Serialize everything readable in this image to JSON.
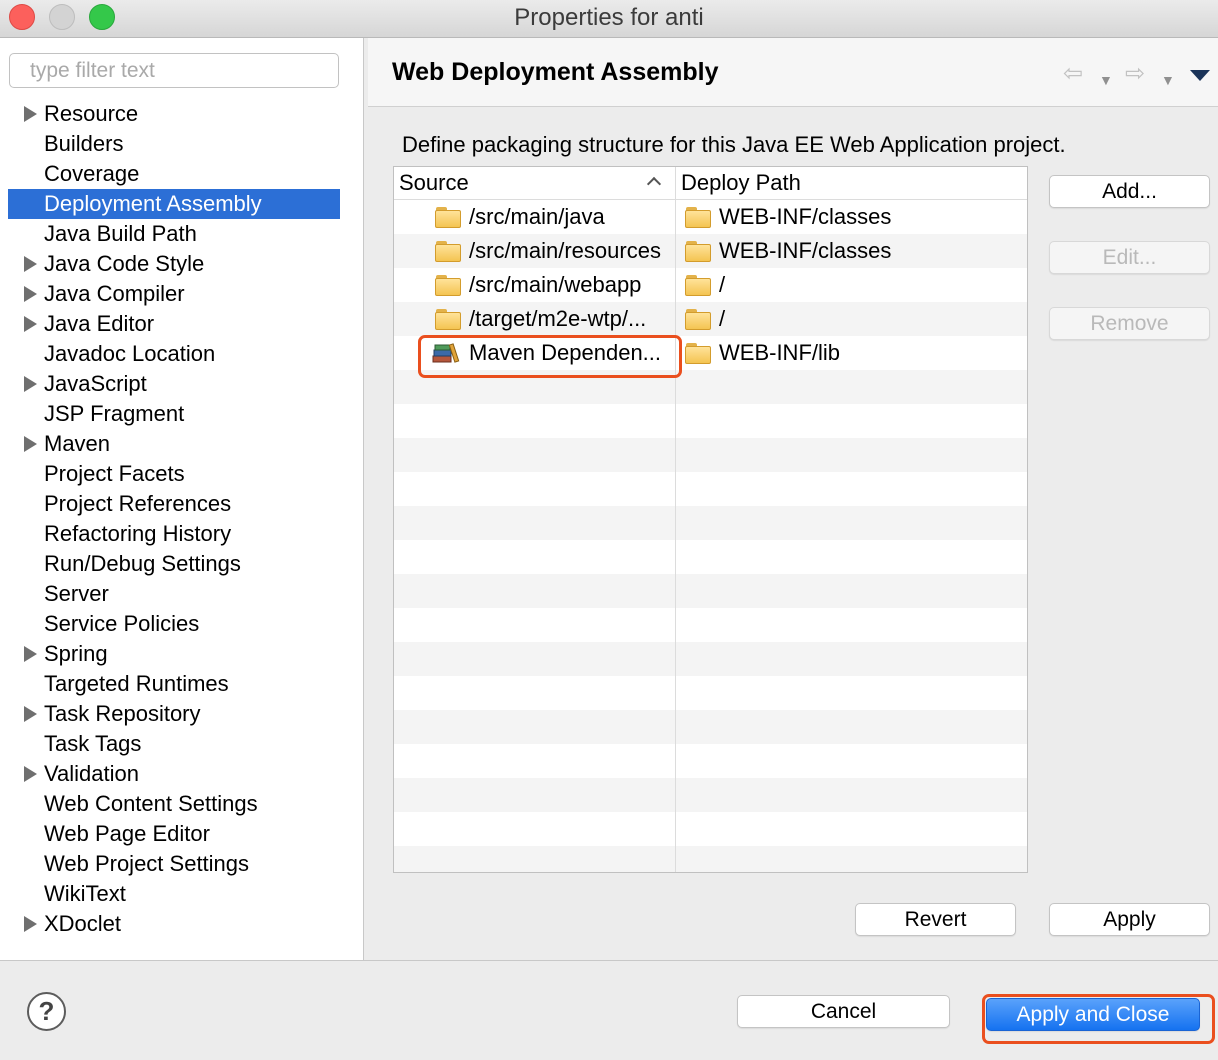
{
  "window": {
    "title": "Properties for anti"
  },
  "filter": {
    "placeholder": "type filter text",
    "value": ""
  },
  "tree": [
    {
      "label": "Resource",
      "expandable": true
    },
    {
      "label": "Builders",
      "expandable": false
    },
    {
      "label": "Coverage",
      "expandable": false
    },
    {
      "label": "Deployment Assembly",
      "expandable": false,
      "selected": true
    },
    {
      "label": "Java Build Path",
      "expandable": false
    },
    {
      "label": "Java Code Style",
      "expandable": true
    },
    {
      "label": "Java Compiler",
      "expandable": true
    },
    {
      "label": "Java Editor",
      "expandable": true
    },
    {
      "label": "Javadoc Location",
      "expandable": false
    },
    {
      "label": "JavaScript",
      "expandable": true
    },
    {
      "label": "JSP Fragment",
      "expandable": false
    },
    {
      "label": "Maven",
      "expandable": true
    },
    {
      "label": "Project Facets",
      "expandable": false
    },
    {
      "label": "Project References",
      "expandable": false
    },
    {
      "label": "Refactoring History",
      "expandable": false
    },
    {
      "label": "Run/Debug Settings",
      "expandable": false
    },
    {
      "label": "Server",
      "expandable": false
    },
    {
      "label": "Service Policies",
      "expandable": false
    },
    {
      "label": "Spring",
      "expandable": true
    },
    {
      "label": "Targeted Runtimes",
      "expandable": false
    },
    {
      "label": "Task Repository",
      "expandable": true
    },
    {
      "label": "Task Tags",
      "expandable": false
    },
    {
      "label": "Validation",
      "expandable": true
    },
    {
      "label": "Web Content Settings",
      "expandable": false
    },
    {
      "label": "Web Page Editor",
      "expandable": false
    },
    {
      "label": "Web Project Settings",
      "expandable": false
    },
    {
      "label": "WikiText",
      "expandable": false
    },
    {
      "label": "XDoclet",
      "expandable": true
    }
  ],
  "page": {
    "heading": "Web Deployment Assembly",
    "description": "Define packaging structure for this Java EE Web Application project."
  },
  "table": {
    "headers": {
      "source": "Source",
      "deploy_path": "Deploy Path"
    },
    "rows": [
      {
        "source": "/src/main/java",
        "source_icon": "folder-icon",
        "deploy_path": "WEB-INF/classes"
      },
      {
        "source": "/src/main/resources",
        "source_icon": "folder-icon",
        "deploy_path": "WEB-INF/classes"
      },
      {
        "source": "/src/main/webapp",
        "source_icon": "folder-icon",
        "deploy_path": "/"
      },
      {
        "source": "/target/m2e-wtp/...",
        "source_icon": "folder-icon",
        "deploy_path": "/"
      },
      {
        "source": "Maven Dependen...",
        "source_icon": "library-icon",
        "deploy_path": "WEB-INF/lib"
      }
    ],
    "empty_rows": 15
  },
  "buttons": {
    "add": "Add...",
    "edit": "Edit...",
    "remove": "Remove",
    "revert": "Revert",
    "apply": "Apply",
    "cancel": "Cancel",
    "apply_and_close": "Apply and Close",
    "help": "?"
  },
  "colors": {
    "selection": "#2c6fd6",
    "highlight": "#ea4f1e",
    "default_button": "#1572f0"
  }
}
